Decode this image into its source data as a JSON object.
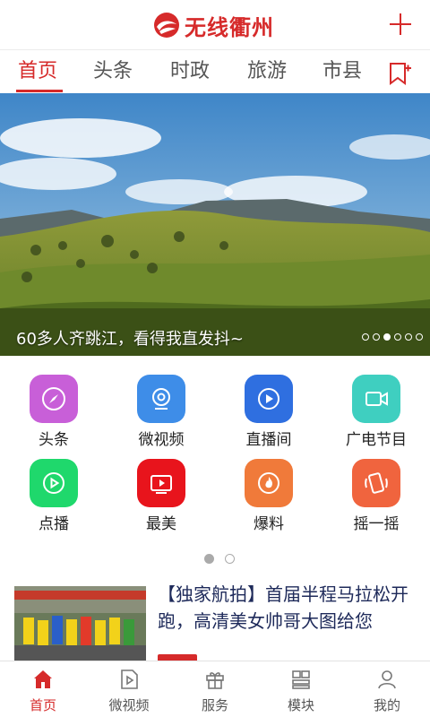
{
  "header": {
    "logo_text": "无线衢州",
    "brand_color": "#d62a2a",
    "logo_icon": "brand-logo-icon",
    "add_icon": "plus-icon"
  },
  "tabs": [
    {
      "label": "首页",
      "active": true
    },
    {
      "label": "头条",
      "active": false
    },
    {
      "label": "时政",
      "active": false
    },
    {
      "label": "旅游",
      "active": false
    },
    {
      "label": "市县",
      "active": false
    }
  ],
  "tab_add_icon": "bookmark-plus-icon",
  "banner": {
    "caption": "60多人齐跳江，看得我直发抖~",
    "slide_count": 6,
    "active_slide": 3
  },
  "grid": {
    "items": [
      {
        "label": "头条",
        "icon": "compass-icon",
        "color": "#c85fd8"
      },
      {
        "label": "微视频",
        "icon": "camera-icon",
        "color": "#3e8de8"
      },
      {
        "label": "直播间",
        "icon": "play-circle-icon",
        "color": "#2f6fe0"
      },
      {
        "label": "广电节目",
        "icon": "video-camera-icon",
        "color": "#3fcfc0"
      },
      {
        "label": "点播",
        "icon": "play-icon",
        "color": "#1fd86c"
      },
      {
        "label": "最美",
        "icon": "tv-play-icon",
        "color": "#e8141c"
      },
      {
        "label": "爆料",
        "icon": "fire-icon",
        "color": "#f07a3a"
      },
      {
        "label": "摇一摇",
        "icon": "shake-phone-icon",
        "color": "#f0643e"
      }
    ],
    "page_count": 2,
    "active_page": 1
  },
  "news": {
    "title": "【独家航拍】首届半程马拉松开跑，高清美女帅哥大图给您"
  },
  "bottom_nav": [
    {
      "label": "首页",
      "icon": "home-icon",
      "active": true
    },
    {
      "label": "微视频",
      "icon": "video-file-icon",
      "active": false
    },
    {
      "label": "服务",
      "icon": "gift-icon",
      "active": false
    },
    {
      "label": "模块",
      "icon": "modules-icon",
      "active": false
    },
    {
      "label": "我的",
      "icon": "user-icon",
      "active": false
    }
  ]
}
